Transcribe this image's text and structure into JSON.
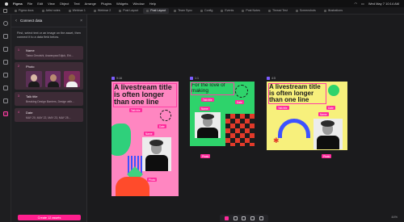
{
  "menubar": {
    "items": [
      "Figma",
      "File",
      "Edit",
      "View",
      "Object",
      "Text",
      "Arrange",
      "Plugins",
      "Widgets",
      "Window",
      "Help"
    ],
    "clock": "Wed May 7  10:14 AM"
  },
  "tabs": [
    {
      "label": "Figma docs",
      "active": false
    },
    {
      "label": "Artist notes",
      "active": false
    },
    {
      "label": "Webinar 1",
      "active": false
    },
    {
      "label": "Webinar 2",
      "active": false
    },
    {
      "label": "Post Layout",
      "active": false
    },
    {
      "label": "Post Layout",
      "active": true
    },
    {
      "label": "Team Sync",
      "active": false
    },
    {
      "label": "Config",
      "active": false
    },
    {
      "label": "Events",
      "active": false
    },
    {
      "label": "Post Notes",
      "active": false
    },
    {
      "label": "Thread Test",
      "active": false
    },
    {
      "label": "Screenshots",
      "active": false
    },
    {
      "label": "Illustrations",
      "active": false
    }
  ],
  "panel": {
    "back_icon": "chevron-left-icon",
    "title": "Connect data",
    "close": "×",
    "instructions": "First, select text or an image on the asset, then connect it to a data field below.",
    "fields": [
      {
        "num": "1",
        "name": "Name",
        "value": "Taiwo Omotshi, Aswanyaa Edjuk, Ehi..."
      },
      {
        "num": "2",
        "name": "Photo",
        "value": ""
      },
      {
        "num": "3",
        "name": "Talk title",
        "value": "Breaking Design Barriers, Design with..."
      },
      {
        "num": "4",
        "name": "Date",
        "value": "MAY 20, MAY 22, MAY 23, MAY 25..."
      }
    ],
    "cta": "Create 12 assets"
  },
  "topright": {
    "export": "Export",
    "share": "Share"
  },
  "frames": [
    {
      "label": "9:16",
      "title": "A livestream title is often longer than one line",
      "pills": {
        "talk": "Talk title",
        "date": "Date",
        "name": "Name",
        "photo": "Photo"
      }
    },
    {
      "label": "1:1",
      "title": "For the love of making",
      "pills": {
        "talk": "Talk title",
        "date": "Date",
        "name": "Name",
        "photo": "Photo"
      }
    },
    {
      "label": "4:5",
      "title": "A livestream title is often longer than one line",
      "pills": {
        "talk": "Talk title",
        "date": "Date",
        "name": "Name",
        "photo": "Photo"
      }
    }
  ],
  "colors": {
    "accent": "#ff2a9b",
    "frame1_bg": "#ff7eb9",
    "frame2_bg": "#2bd66a",
    "frame3_bg": "#f7f07a"
  },
  "zoom": "44%"
}
